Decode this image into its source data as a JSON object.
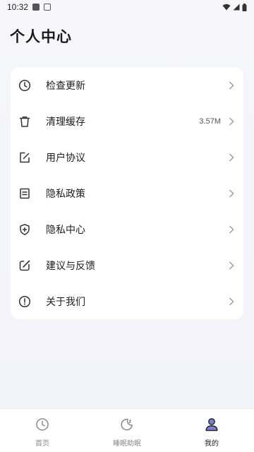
{
  "status_bar": {
    "time": "10:32"
  },
  "page": {
    "title": "个人中心"
  },
  "menu": {
    "items": [
      {
        "label": "检查更新",
        "icon": "clock-icon"
      },
      {
        "label": "清理缓存",
        "icon": "trash-icon",
        "value": "3.57M"
      },
      {
        "label": "用户协议",
        "icon": "edit-document-icon"
      },
      {
        "label": "隐私政策",
        "icon": "document-icon"
      },
      {
        "label": "隐私中心",
        "icon": "shield-plus-icon"
      },
      {
        "label": "建议与反馈",
        "icon": "feedback-edit-icon"
      },
      {
        "label": "关于我们",
        "icon": "info-circle-icon"
      }
    ]
  },
  "tab_bar": {
    "tabs": [
      {
        "label": "首页",
        "icon": "clock-icon"
      },
      {
        "label": "睡眠助眠",
        "icon": "moon-icon"
      },
      {
        "label": "我的",
        "icon": "user-icon"
      }
    ],
    "active_tab": "我的"
  },
  "colors": {
    "accent": "#7b7fd6",
    "background": "#f4f5fa",
    "card": "#ffffff"
  }
}
